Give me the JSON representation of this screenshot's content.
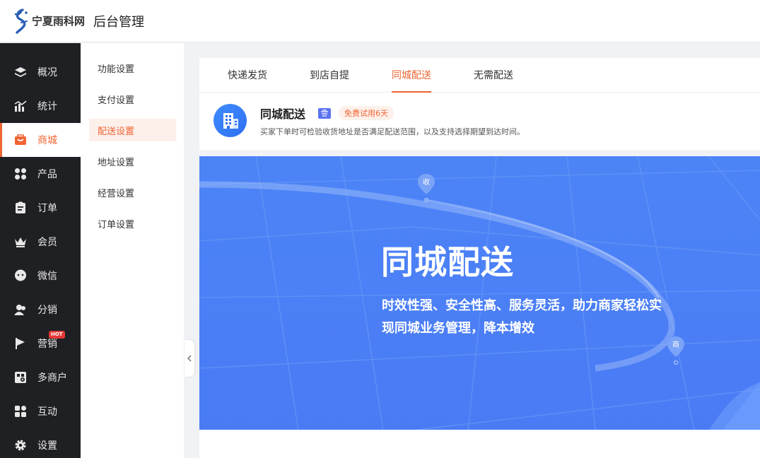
{
  "header": {
    "logo_text": "宁夏雨科网",
    "app_title": "后台管理"
  },
  "sidebar": {
    "items": [
      {
        "label": "概况",
        "icon": "layers-icon"
      },
      {
        "label": "统计",
        "icon": "chart-icon"
      },
      {
        "label": "商城",
        "icon": "shop-icon",
        "active": true
      },
      {
        "label": "产品",
        "icon": "grid-icon"
      },
      {
        "label": "订单",
        "icon": "order-icon"
      },
      {
        "label": "会员",
        "icon": "crown-icon"
      },
      {
        "label": "微信",
        "icon": "chat-icon"
      },
      {
        "label": "分销",
        "icon": "users-icon"
      },
      {
        "label": "营销",
        "icon": "flag-icon",
        "badge": "HOT"
      },
      {
        "label": "多商户",
        "icon": "store-icon"
      },
      {
        "label": "互动",
        "icon": "interact-icon"
      },
      {
        "label": "设置",
        "icon": "gear-icon"
      }
    ]
  },
  "submenu": {
    "items": [
      {
        "label": "功能设置"
      },
      {
        "label": "支付设置"
      },
      {
        "label": "配送设置",
        "active": true
      },
      {
        "label": "地址设置"
      },
      {
        "label": "经营设置"
      },
      {
        "label": "订单设置"
      }
    ]
  },
  "tabs": [
    {
      "label": "快递发货"
    },
    {
      "label": "到店自提"
    },
    {
      "label": "同城配送",
      "active": true
    },
    {
      "label": "无需配送"
    }
  ],
  "feature": {
    "title": "同城配送",
    "trial_badge": "免费试用6天",
    "description": "买家下单时可检验收货地址是否满足配送范围，以及支持选择期望到达时间。"
  },
  "banner": {
    "title": "同城配送",
    "subtitle": "时效性强、安全性高、服务灵活，助力商家轻松实现同城业务管理，降本增效",
    "pin_receive": "收",
    "pin_shop": "商"
  },
  "colors": {
    "accent": "#ef6533",
    "sidebar_bg": "#1f2024",
    "banner_bg": "#4c84f6"
  }
}
